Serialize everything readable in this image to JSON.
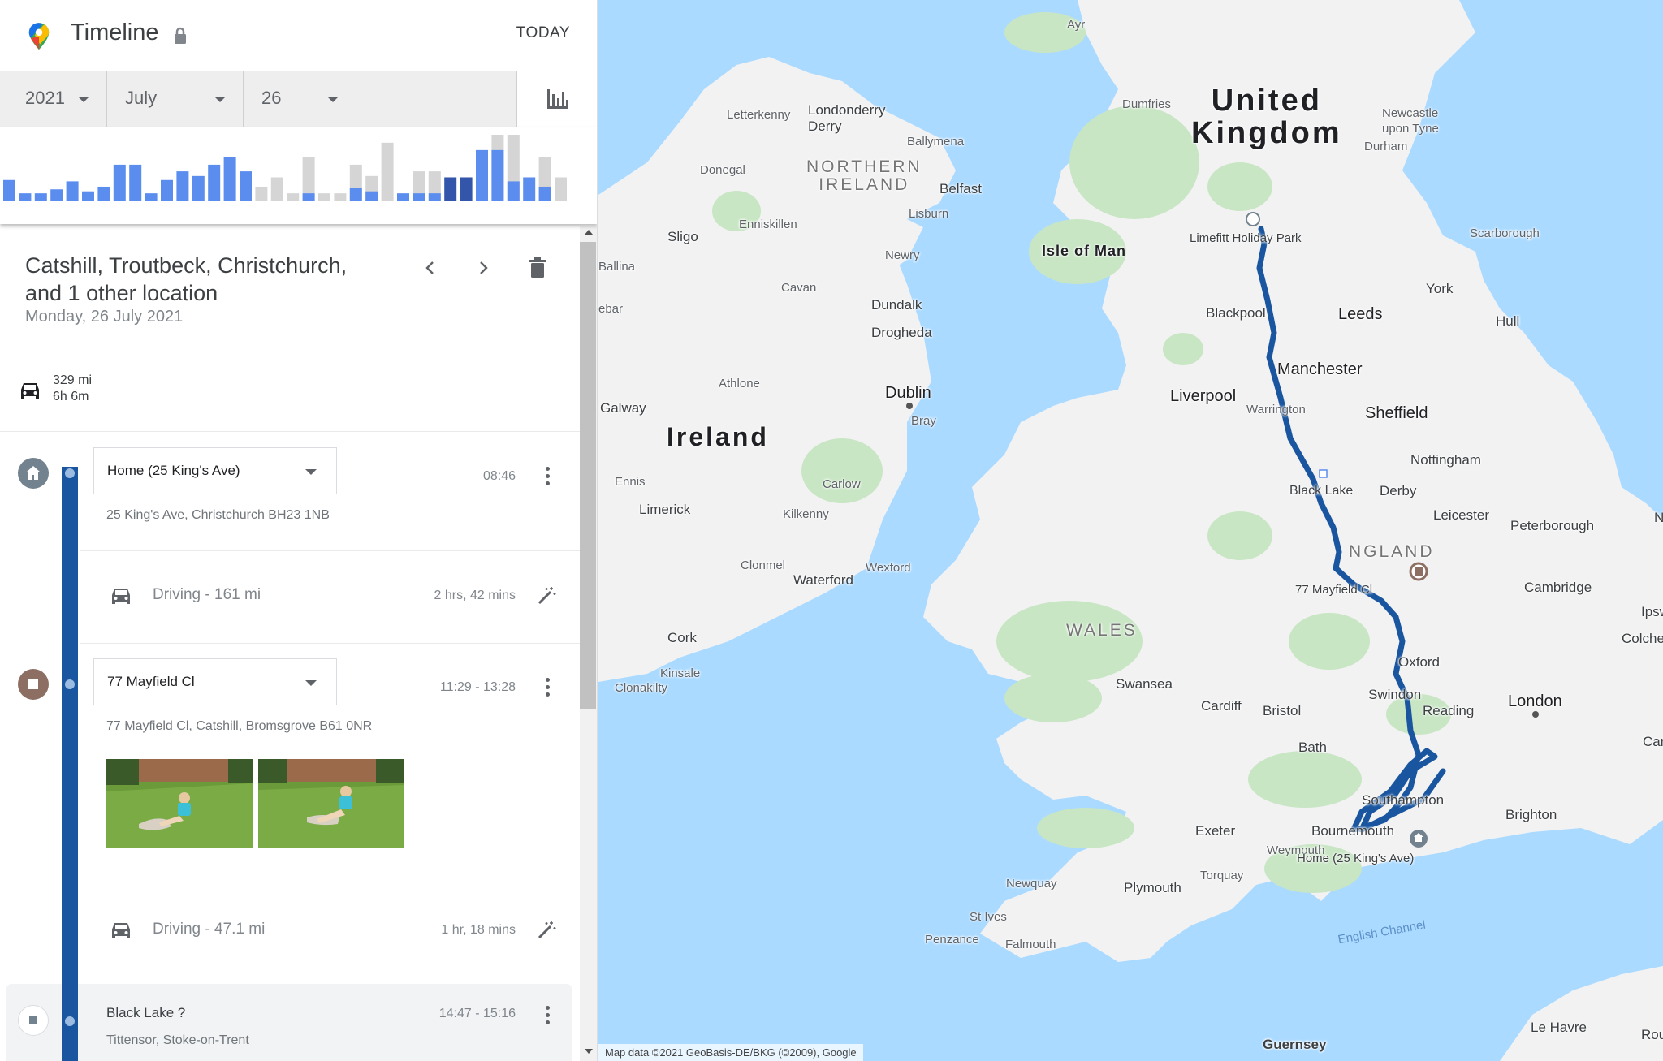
{
  "header": {
    "title": "Timeline",
    "today_label": "TODAY"
  },
  "date_selector": {
    "year": "2021",
    "month": "July",
    "day": "26"
  },
  "histogram": {
    "bars": [
      {
        "h": 0.32,
        "c": "#5b8def"
      },
      {
        "h": 0.12,
        "c": "#5b8def"
      },
      {
        "h": 0.12,
        "c": "#5b8def"
      },
      {
        "h": 0.18,
        "c": "#5b8def"
      },
      {
        "h": 0.3,
        "c": "#5b8def"
      },
      {
        "h": 0.15,
        "c": "#5b8def"
      },
      {
        "h": 0.22,
        "c": "#5b8def"
      },
      {
        "h": 0.55,
        "c": "#5b8def"
      },
      {
        "h": 0.55,
        "c": "#5b8def"
      },
      {
        "h": 0.12,
        "c": "#5b8def"
      },
      {
        "h": 0.32,
        "c": "#5b8def"
      },
      {
        "h": 0.45,
        "c": "#5b8def"
      },
      {
        "h": 0.38,
        "c": "#5b8def"
      },
      {
        "h": 0.55,
        "c": "#5b8def"
      },
      {
        "h": 0.66,
        "c": "#5b8def"
      },
      {
        "h": 0.45,
        "c": "#5b8def"
      },
      {
        "h": 0.22,
        "c": "#d5d5d5"
      },
      {
        "h": 0.36,
        "c": "#d5d5d5"
      },
      {
        "h": 0.12,
        "c": "#d5d5d5"
      },
      {
        "h": 0.66,
        "c": "#d5d5d5",
        "b": 0.12
      },
      {
        "h": 0.12,
        "c": "#d5d5d5"
      },
      {
        "h": 0.12,
        "c": "#d5d5d5"
      },
      {
        "h": 0.55,
        "c": "#d5d5d5",
        "b": 0.2
      },
      {
        "h": 0.38,
        "c": "#d5d5d5",
        "b": 0.15
      },
      {
        "h": 0.88,
        "c": "#d5d5d5"
      },
      {
        "h": 0.12,
        "c": "#5b8def"
      },
      {
        "h": 0.45,
        "c": "#d5d5d5",
        "b": 0.12
      },
      {
        "h": 0.45,
        "c": "#d5d5d5",
        "b": 0.12
      },
      {
        "h": 0.36,
        "c": "#3355aa"
      },
      {
        "h": 0.36,
        "c": "#3355aa"
      },
      {
        "h": 0.77,
        "c": "#5b8def"
      },
      {
        "h": 1.0,
        "c": "#d5d5d5",
        "b": 0.77
      },
      {
        "h": 1.0,
        "c": "#d5d5d5",
        "b": 0.3
      },
      {
        "h": 0.36,
        "c": "#5b8def"
      },
      {
        "h": 0.66,
        "c": "#d5d5d5",
        "b": 0.22
      },
      {
        "h": 0.36,
        "c": "#d5d5d5"
      }
    ]
  },
  "day": {
    "title": "Catshill, Troutbeck, Christchurch, and 1 other location",
    "date": "Monday, 26 July 2021",
    "summary_distance": "329 mi",
    "summary_duration": "6h 6m"
  },
  "timeline": {
    "home": {
      "name": "Home (25 King's Ave)",
      "address": "25 King's Ave, Christchurch BH23 1NB",
      "time": "08:46"
    },
    "drive1": {
      "label": "Driving",
      "distance": "161 mi",
      "duration": "2 hrs, 42 mins"
    },
    "stop1": {
      "name": "77 Mayfield Cl",
      "address": "77 Mayfield Cl, Catshill, Bromsgrove B61 0NR",
      "time": "11:29 - 13:28"
    },
    "drive2": {
      "label": "Driving",
      "distance": "47.1 mi",
      "duration": "1 hr, 18 mins"
    },
    "stop2": {
      "name": "Black Lake ?",
      "address": "Tittensor, Stoke-on-Trent",
      "time": "14:47 - 15:16"
    }
  },
  "icons": {
    "logo": "google-maps-pin-icon",
    "lock": "lock-icon",
    "stats": "bar-chart-icon",
    "prev": "chevron-left-icon",
    "next": "chevron-right-icon",
    "delete": "trash-icon",
    "car": "car-icon",
    "home": "home-icon",
    "stop": "stop-square-icon",
    "menu": "more-vert-icon",
    "edit": "magic-wand-icon"
  },
  "colors": {
    "route": "#1a56a0",
    "bar_blue": "#5b8def",
    "bar_grey": "#d5d5d5",
    "water": "#aadaff",
    "land": "#f2f2f2",
    "forest": "#c8e6c4"
  },
  "map": {
    "labels": {
      "uk": "United Kingdom",
      "ireland": "Ireland",
      "northern_ireland": "NORTHERN IRELAND",
      "wales": "WALES",
      "england": "NGLAND",
      "isle_of_man": "Isle of Man",
      "ayr": "Ayr",
      "dumfries": "Dumfries",
      "newcastle": "Newcastle upon Tyne",
      "durham": "Durham",
      "letterkenny": "Letterkenny",
      "londonderry": "Londonderry Derry",
      "ballymena": "Ballymena",
      "donegal": "Donegal",
      "belfast": "Belfast",
      "lisburn": "Lisburn",
      "enniskillen": "Enniskillen",
      "sligo": "Sligo",
      "newry": "Newry",
      "ballina": "Ballina",
      "cavan": "Cavan",
      "dundalk": "Dundalk",
      "drogheda": "Drogheda",
      "ebar": "ebar",
      "athlone": "Athlone",
      "dublin": "Dublin",
      "bray": "Bray",
      "galway": "Galway",
      "ennis": "Ennis",
      "carlow": "Carlow",
      "limerick": "Limerick",
      "kilkenny": "Kilkenny",
      "clonmel": "Clonmel",
      "wexford": "Wexford",
      "waterford": "Waterford",
      "cork": "Cork",
      "kinsale": "Kinsale",
      "clonakilty": "Clonakilty",
      "limefitt": "Limefitt Holiday Park",
      "scarborough": "Scarborough",
      "york": "York",
      "blackpool": "Blackpool",
      "leeds": "Leeds",
      "hull": "Hull",
      "manchester": "Manchester",
      "liverpool": "Liverpool",
      "warrington": "Warrington",
      "sheffield": "Sheffield",
      "nottingham": "Nottingham",
      "black_lake": "Black Lake",
      "derby": "Derby",
      "leicester": "Leicester",
      "peterborough": "Peterborough",
      "mayfield": "77 Mayfield Cl",
      "cambridge": "Cambridge",
      "ipsw": "Ipsw",
      "colchester": "Colchest",
      "oxford": "Oxford",
      "swansea": "Swansea",
      "swindon": "Swindon",
      "cardiff": "Cardiff",
      "bristol": "Bristol",
      "reading": "Reading",
      "london": "London",
      "cante": "Cante",
      "bath": "Bath",
      "southampton": "Southampton",
      "exeter": "Exeter",
      "bournemouth": "Bournemouth",
      "brighton": "Brighton",
      "weymouth": "Weymouth",
      "home": "Home (25 King's Ave)",
      "newquay": "Newquay",
      "plymouth": "Plymouth",
      "torquay": "Torquay",
      "st_ives": "St Ives",
      "penzance": "Penzance",
      "falmouth": "Falmouth",
      "english_channel": "English Channel",
      "guernsey": "Guernsey",
      "le_havre": "Le Havre",
      "rou": "Rou",
      "n": "N"
    },
    "attribution": "Map data ©2021 GeoBasis-DE/BKG (©2009), Google"
  }
}
